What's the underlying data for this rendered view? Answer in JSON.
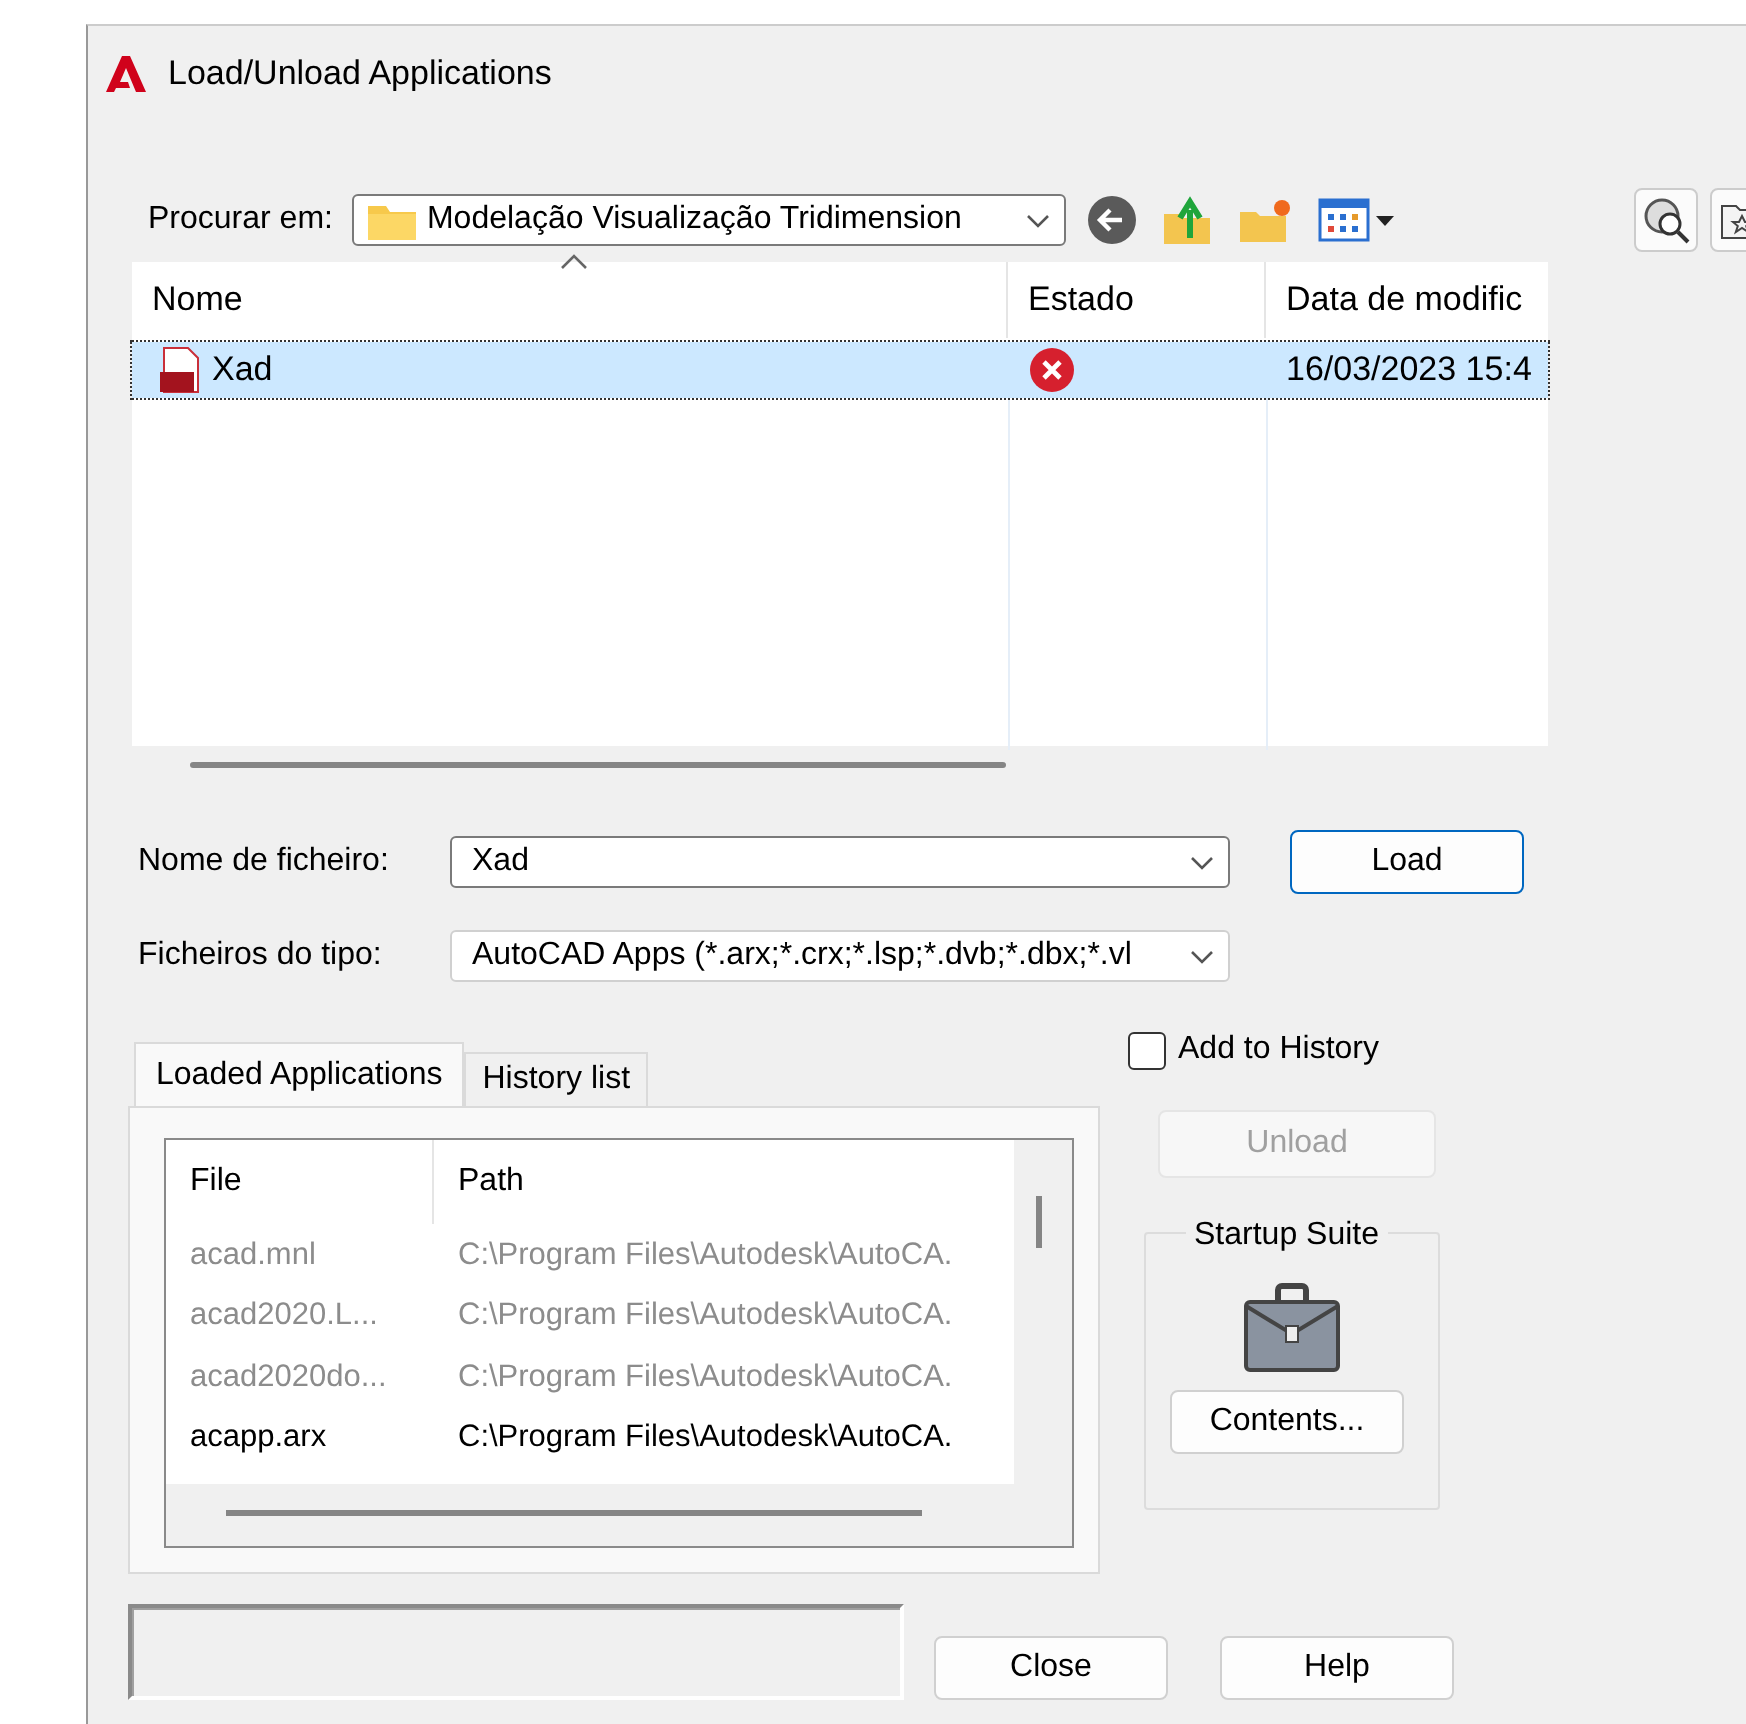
{
  "window": {
    "title": "Load/Unload Applications"
  },
  "look_in": {
    "label": "Procurar em:",
    "value": "Modelação Visualização Tridimension"
  },
  "file_list": {
    "columns": [
      "Nome",
      "Estado",
      "Data de modific"
    ],
    "rows": [
      {
        "name": "Xad",
        "kind": "error",
        "modified": "16/03/2023 15:4",
        "selected": true
      }
    ]
  },
  "file_name": {
    "label": "Nome de ficheiro:",
    "value": "Xad"
  },
  "file_type": {
    "label": "Ficheiros do tipo:",
    "value": "AutoCAD Apps (*.arx;*.crx;*.lsp;*.dvb;*.dbx;*.vl"
  },
  "load_button": {
    "label": "Load"
  },
  "tabs": [
    {
      "label": "Loaded Applications",
      "selected": true
    },
    {
      "label": "History list",
      "selected": false
    }
  ],
  "loaded_apps": {
    "columns": [
      "File",
      "Path"
    ],
    "rows": [
      {
        "file": "acad.mnl",
        "path": "C:\\Program Files\\Autodesk\\AutoCA.",
        "greyed": true
      },
      {
        "file": "acad2020.L...",
        "path": "C:\\Program Files\\Autodesk\\AutoCA.",
        "greyed": true
      },
      {
        "file": "acad2020do...",
        "path": "C:\\Program Files\\Autodesk\\AutoCA.",
        "greyed": true
      },
      {
        "file": "acapp.arx",
        "path": "C:\\Program Files\\Autodesk\\AutoCA.",
        "greyed": false
      }
    ]
  },
  "add_to_history": {
    "label": "Add to History",
    "checked": false
  },
  "unload_button": {
    "label": "Unload",
    "disabled": true
  },
  "startup_suite": {
    "title": "Startup Suite",
    "button": "Contents..."
  },
  "footer_buttons": [
    {
      "label": "Close"
    },
    {
      "label": "Help"
    }
  ]
}
